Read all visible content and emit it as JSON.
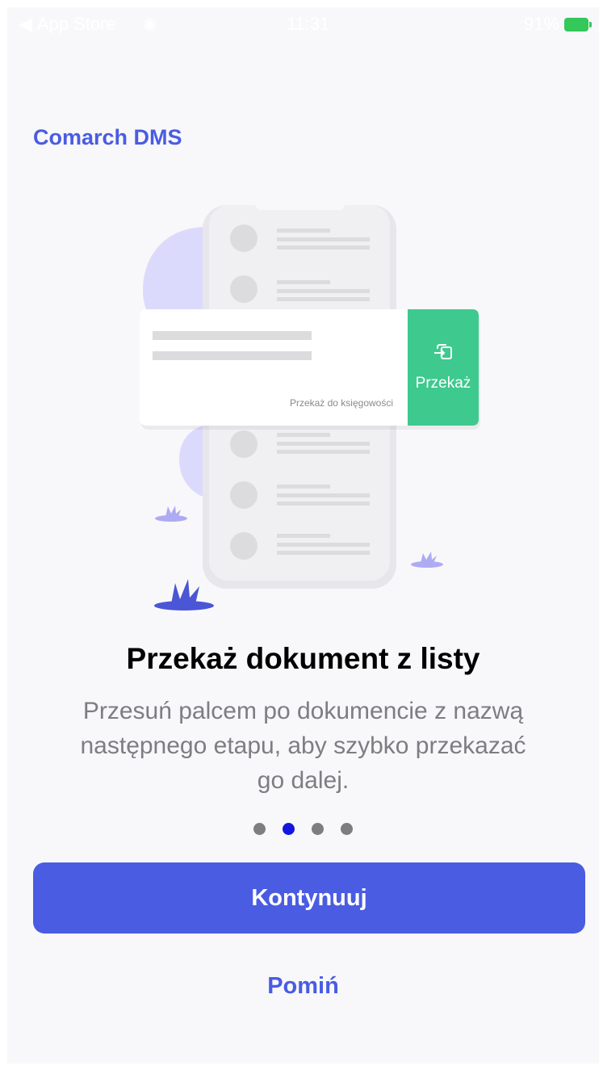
{
  "status_bar": {
    "back_label": "App Store",
    "time": "11:31",
    "battery_percent": "91%",
    "battery_color": "#34c759"
  },
  "app": {
    "title": "Comarch DMS"
  },
  "illustration": {
    "card_hint": "Przekaż do księgowości",
    "action_label": "Przekaż",
    "action_icon": "transfer-icon",
    "action_color": "#3ec98f",
    "accent_color": "#dcdafc"
  },
  "content": {
    "title": "Przekaż dokument z listy",
    "description": "Przesuń palcem po dokumencie z nazwą następnego etapu, aby szybko przekazać go dalej."
  },
  "pagination": {
    "total": 4,
    "active_index": 1,
    "active_color": "#1515e0"
  },
  "buttons": {
    "continue_label": "Kontynuuj",
    "skip_label": "Pomiń",
    "brand_color": "#4a5ce2"
  }
}
